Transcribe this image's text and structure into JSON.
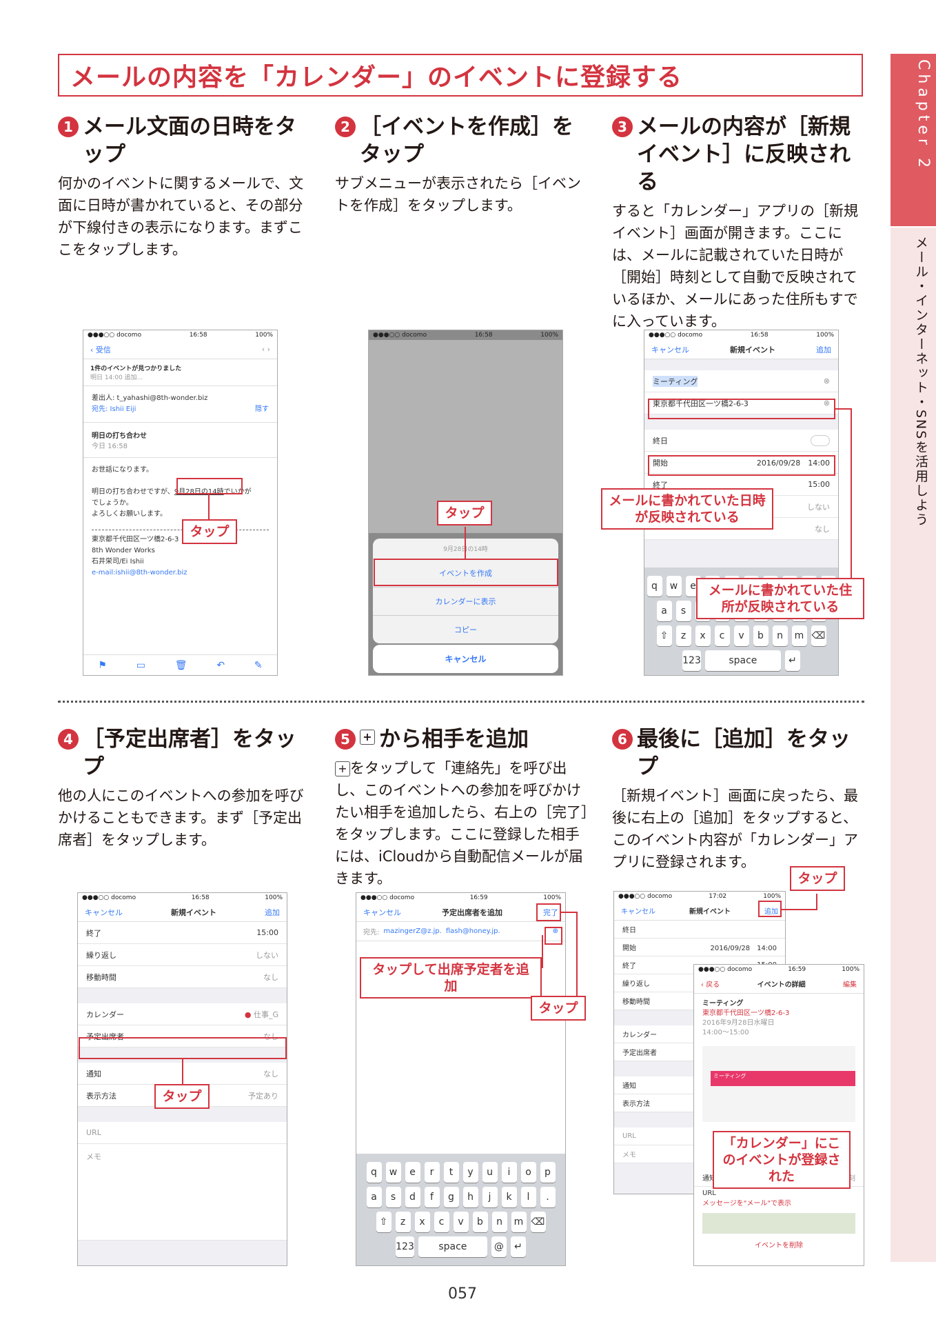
{
  "title": "メールの内容を「カレンダー」のイベントに登録する",
  "side": {
    "chapter": "Chapter 2",
    "section": "メール・インターネット・SNSを活用しよう"
  },
  "steps": [
    {
      "num": "1",
      "title": "メール文面の日時をタップ",
      "body": "何かのイベントに関するメールで、文面に日時が書かれていると、その部分が下線付きの表示になります。まずここをタップします。"
    },
    {
      "num": "2",
      "title": "［イベントを作成］をタップ",
      "body": "サブメニューが表示されたら［イベントを作成］をタップします。"
    },
    {
      "num": "3",
      "title": "メールの内容が［新規イベント］に反映される",
      "body": "すると「カレンダー」アプリの［新規イベント］画面が開きます。ここには、メールに記載されていた日時が［開始］時刻として自動で反映されているほか、メールにあった住所もすでに入っています。"
    },
    {
      "num": "4",
      "title": "［予定出席者］をタップ",
      "body": "他の人にこのイベントへの参加を呼びかけることもできます。まず［予定出席者］をタップします。"
    },
    {
      "num": "5",
      "title": "から相手を追加",
      "body": "をタップして「連絡先」を呼び出し、このイベントへの参加を呼びかけたい相手を追加したら、右上の［完了］をタップします。ここに登録した相手には、iCloudから自動配信メールが届きます。"
    },
    {
      "num": "6",
      "title": "最後に［追加］をタップ",
      "body": "［新規イベント］画面に戻ったら、最後に右上の［追加］をタップすると、このイベント内容が「カレンダー」アプリに登録されます。"
    }
  ],
  "status": {
    "carrier": "●●●○○ docomo",
    "time1": "16:58",
    "time2": "16:59",
    "time3": "17:02",
    "battery": "100%"
  },
  "s1": {
    "back": "受信",
    "banner": "1件のイベントが見つかりました",
    "banner_sub": "明日 14:00  追加...",
    "from": "差出人: t_yahashi@8th-wonder.biz",
    "to": "宛先: Ishii Eiji",
    "hide": "隠す",
    "subject": "明日の打ち合わせ",
    "date": "今日 16:58",
    "l1": "お世話になります。",
    "l2": "明日の打ち合わせですが、",
    "l2d": "9月28日の14時",
    "l2e": "でいかが",
    "l3": "でしょうか。",
    "l4": "よろしくお願いします。",
    "sig1": "東京都千代田区一ツ橋2-6-3",
    "sig2": "8th Wonder Works",
    "sig3": "石井栄司/Ei Ishii",
    "sig4": "e-mail:ishii@8th-wonder.biz",
    "callout": "タップ"
  },
  "s2": {
    "menu_title": "9月28日の14時",
    "m1": "イベントを作成",
    "m2": "カレンダーに表示",
    "m3": "コピー",
    "cancel": "キャンセル",
    "callout": "タップ"
  },
  "s3": {
    "cancel": "キャンセル",
    "title": "新規イベント",
    "add": "追加",
    "event": "ミーティング",
    "addr": "東京都千代田区一ツ橋2-6-3",
    "allday": "終日",
    "start": "開始",
    "start_v": "2016/09/28　14:00",
    "end": "終了",
    "end_v": "15:00",
    "none": "しない",
    "none2": "なし",
    "space": "space",
    "c1": "メールに書かれていた日時が反映されている",
    "c2": "メールに書かれていた住所が反映されている"
  },
  "s4": {
    "end": "終了",
    "end_v": "15:00",
    "repeat": "繰り返し",
    "repeat_v": "しない",
    "travel": "移動時間",
    "travel_v": "なし",
    "cal": "カレンダー",
    "cal_v": "仕事_G",
    "inv": "予定出席者",
    "inv_v": "なし",
    "alert": "通知",
    "alert_v": "なし",
    "show": "表示方法",
    "show_v": "予定あり",
    "url": "URL",
    "memo": "メモ",
    "callout": "タップ"
  },
  "s5": {
    "title": "予定出席者を追加",
    "done": "完了",
    "to": "宛先:",
    "r1": "mazingerZ@z.jp.",
    "r2": "flash@honey.jp.",
    "c1": "タップして出席予定者を追加",
    "c2": "タップ"
  },
  "s6": {
    "back": "戻る",
    "detail": "イベントの詳細",
    "edit": "編集",
    "ev": "ミーティング",
    "addr": "東京都千代田区一ツ橋2-6-3",
    "when": "2016年9月28日水曜日",
    "when2": "14:00〜15:00",
    "start": "開始",
    "start_v": "2016/09/28　14:00",
    "end": "終了",
    "end_v": "15:00",
    "repeat": "繰り返し",
    "travel": "移動時間",
    "cal": "カレンダー",
    "inv": "予定出席者",
    "alert": "通知",
    "show": "表示方法",
    "url": "URL",
    "memo": "メモ",
    "alert_v": "出発時刻",
    "url_v": "メッセージを\"メール\"で表示",
    "delete": "イベントを削除",
    "c1": "タップ",
    "c2": "「カレンダー」にこのイベントが登録された"
  },
  "page": "057"
}
